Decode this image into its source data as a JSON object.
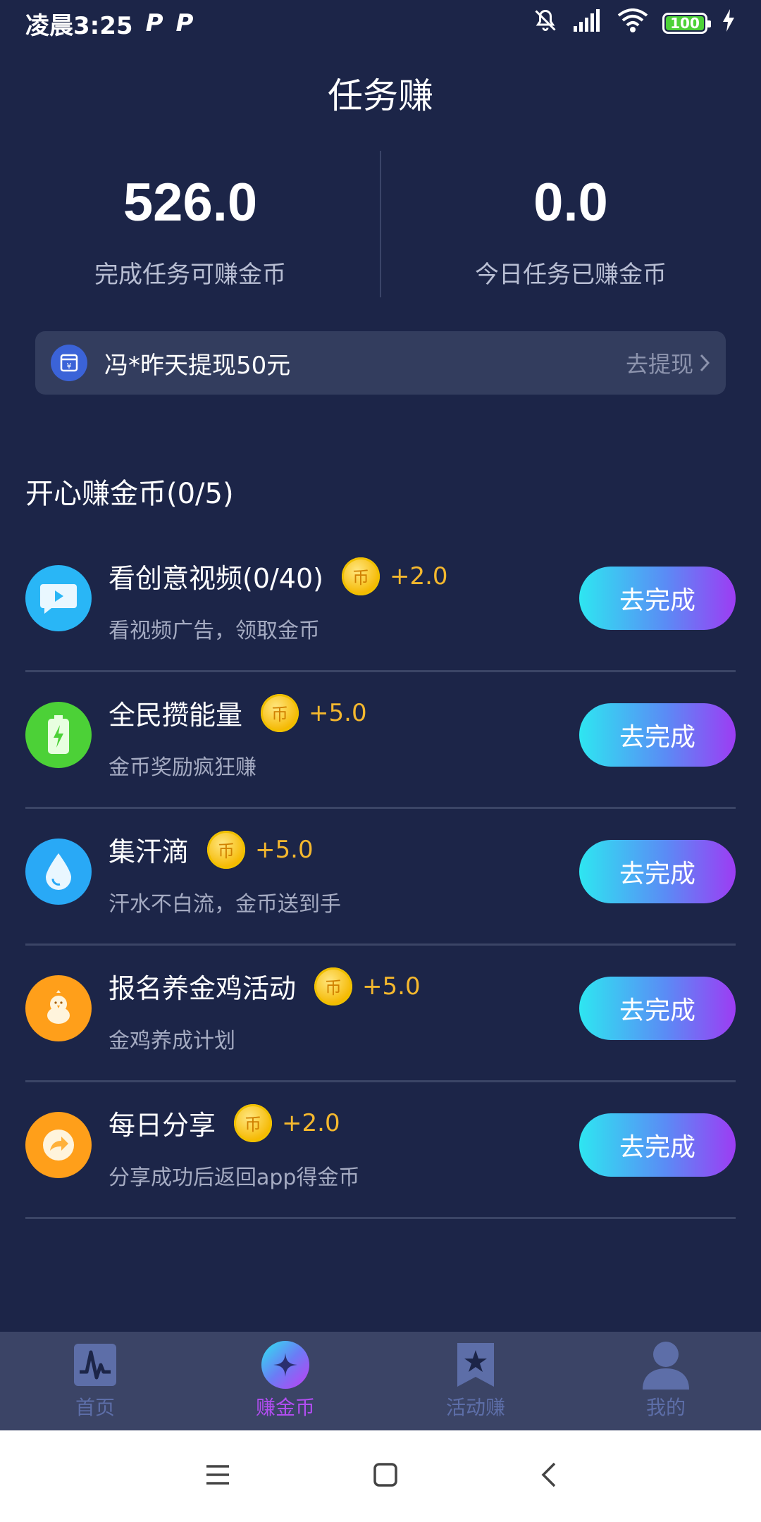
{
  "status_bar": {
    "time": "凌晨3:25",
    "p1": "P",
    "p2": "P",
    "battery": "100"
  },
  "header": {
    "title": "任务赚"
  },
  "stats": [
    {
      "value": "526.0",
      "label": "完成任务可赚金币"
    },
    {
      "value": "0.0",
      "label": "今日任务已赚金币"
    }
  ],
  "notice": {
    "text": "冯*昨天提现50元",
    "link": "去提现"
  },
  "section": {
    "title": "开心赚金币(0/5)"
  },
  "tasks": [
    {
      "title": "看创意视频(0/40)",
      "reward": "+2.0",
      "desc": "看视频广告，领取金币",
      "button": "去完成",
      "coin": "币",
      "icon": "video-icon",
      "color": "#29b6f6"
    },
    {
      "title": "全民攒能量",
      "reward": "+5.0",
      "desc": "金币奖励疯狂赚",
      "button": "去完成",
      "coin": "币",
      "icon": "battery-icon",
      "color": "#4cd137"
    },
    {
      "title": "集汗滴",
      "reward": "+5.0",
      "desc": "汗水不白流，金币送到手",
      "button": "去完成",
      "coin": "币",
      "icon": "drop-icon",
      "color": "#29a9f6"
    },
    {
      "title": "报名养金鸡活动",
      "reward": "+5.0",
      "desc": "金鸡养成计划",
      "button": "去完成",
      "coin": "币",
      "icon": "chick-icon",
      "color": "#ff9f1a"
    },
    {
      "title": "每日分享",
      "reward": "+2.0",
      "desc": "分享成功后返回app得金币",
      "button": "去完成",
      "coin": "币",
      "icon": "share-icon",
      "color": "#ff9f1a"
    }
  ],
  "bottom_nav": [
    {
      "label": "首页",
      "icon": "home-chart-icon"
    },
    {
      "label": "赚金币",
      "icon": "earn-coin-icon",
      "active": true
    },
    {
      "label": "活动赚",
      "icon": "bookmark-star-icon"
    },
    {
      "label": "我的",
      "icon": "user-icon"
    }
  ],
  "colors": {
    "background": "#1c2548",
    "accent": "#f5b82e",
    "active_tab": "#b14df0"
  }
}
